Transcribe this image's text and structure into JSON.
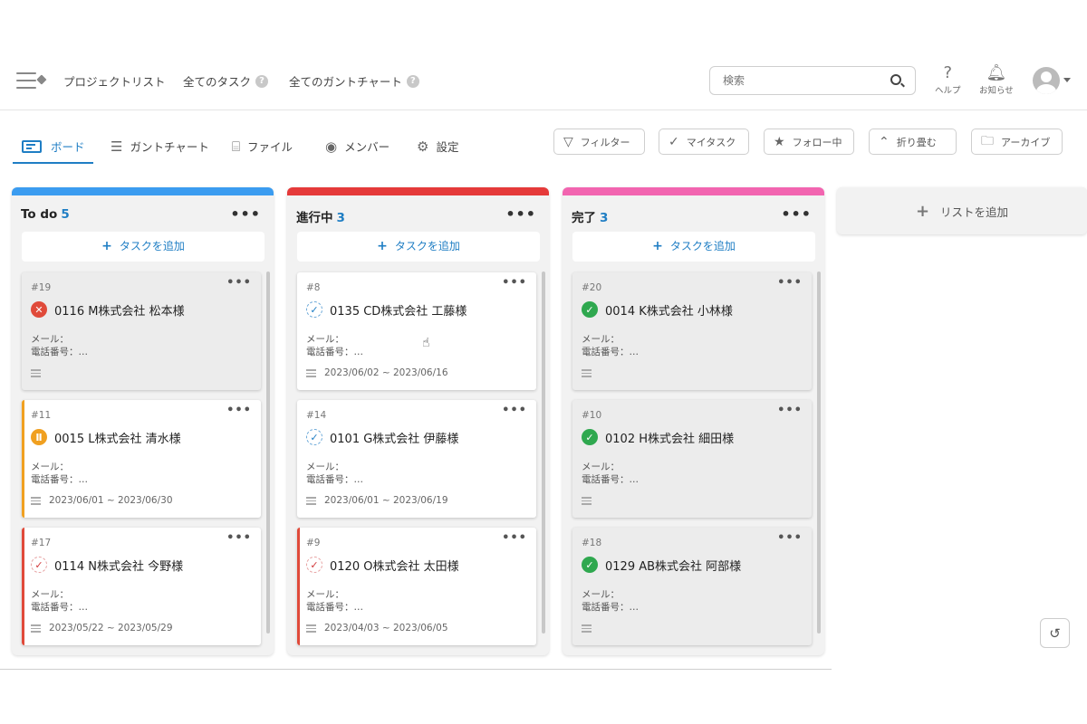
{
  "header": {
    "nav": [
      {
        "label": "プロジェクトリスト",
        "help": ""
      },
      {
        "label": "全てのタスク",
        "help": "?"
      },
      {
        "label": "全てのガントチャート",
        "help": "?"
      }
    ],
    "search_placeholder": "検索",
    "help_label": "ヘルプ",
    "notify_label": "お知らせ"
  },
  "toolbar": {
    "views": [
      "ボード",
      "ガントチャート",
      "ファイル",
      "メンバー",
      "設定"
    ],
    "filters": [
      "フィルター",
      "マイタスク",
      "フォロー中",
      "折り畳む",
      "アーカイブ"
    ]
  },
  "columns": [
    {
      "title": "To do",
      "count": "5",
      "accent": "#3b9cf0",
      "add_label": "タスクを追加",
      "cards": [
        {
          "num": "#19",
          "title": "0116 M株式会社 松本様",
          "mail": "メール：",
          "tel": "電話番号：…",
          "date": "",
          "status": "red"
        },
        {
          "num": "#11",
          "title": "0015 L株式会社 清水様",
          "mail": "メール：",
          "tel": "電話番号：…",
          "date": "2023/06/01 ~ 2023/06/30",
          "status": "orange"
        },
        {
          "num": "#17",
          "title": "0114 N株式会社 今野様",
          "mail": "メール：",
          "tel": "電話番号：…",
          "date": "2023/05/22 ~ 2023/05/29",
          "status": "check-red"
        }
      ]
    },
    {
      "title": "進行中",
      "count": "3",
      "accent": "#e53a3a",
      "add_label": "タスクを追加",
      "cards": [
        {
          "num": "#8",
          "title": "0135 CD株式会社 工藤様",
          "mail": "メール：",
          "tel": "電話番号：…",
          "date": "2023/06/02 ~ 2023/06/16",
          "status": "check"
        },
        {
          "num": "#14",
          "title": "0101 G株式会社 伊藤様",
          "mail": "メール：",
          "tel": "電話番号：…",
          "date": "2023/06/01 ~ 2023/06/19",
          "status": "check"
        },
        {
          "num": "#9",
          "title": "0120 O株式会社 太田様",
          "mail": "メール：",
          "tel": "電話番号：…",
          "date": "2023/04/03 ~ 2023/06/05",
          "status": "check-red"
        }
      ]
    },
    {
      "title": "完了",
      "count": "3",
      "accent": "#f265b0",
      "add_label": "タスクを追加",
      "cards": [
        {
          "num": "#20",
          "title": "0014 K株式会社 小林様",
          "mail": "メール：",
          "tel": "電話番号：…",
          "date": "",
          "status": "green"
        },
        {
          "num": "#10",
          "title": "0102 H株式会社 細田様",
          "mail": "メール：",
          "tel": "電話番号：…",
          "date": "",
          "status": "green"
        },
        {
          "num": "#18",
          "title": "0129 AB株式会社 阿部様",
          "mail": "メール：",
          "tel": "電話番号：…",
          "date": "",
          "status": "green"
        }
      ]
    }
  ],
  "add_list_label": "リストを追加"
}
